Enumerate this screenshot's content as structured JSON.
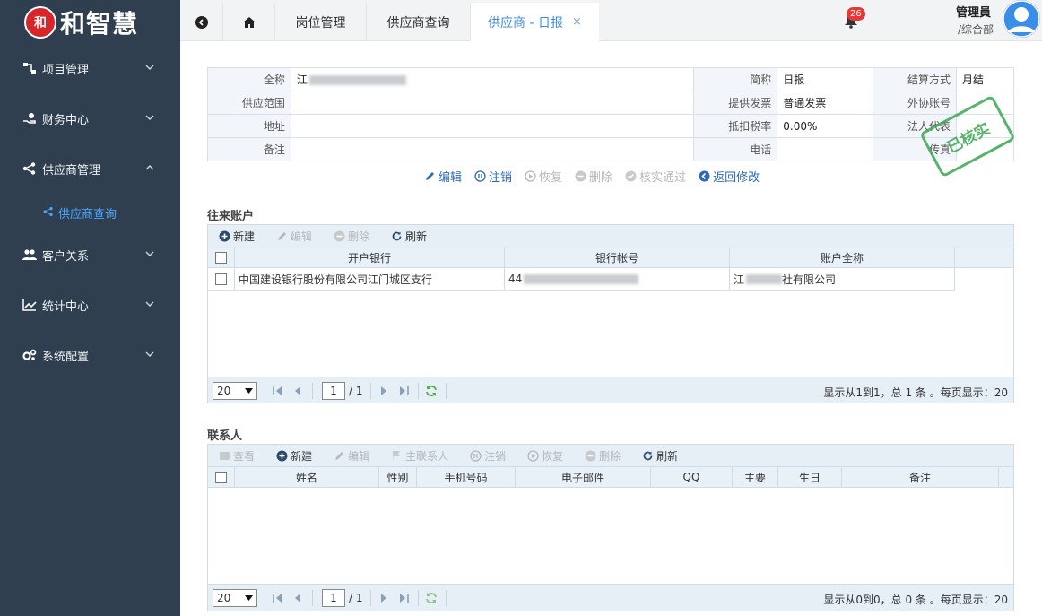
{
  "app": {
    "logo_mark": "和",
    "logo_text": "和智慧"
  },
  "sidebar": {
    "items": [
      {
        "label": "项目管理",
        "icon": "sitemap-icon"
      },
      {
        "label": "财务中心",
        "icon": "hand-coin-icon"
      },
      {
        "label": "供应商管理",
        "icon": "share-icon"
      },
      {
        "label": "客户关系",
        "icon": "users-icon"
      },
      {
        "label": "统计中心",
        "icon": "line-chart-icon"
      },
      {
        "label": "系统配置",
        "icon": "gears-icon"
      }
    ],
    "sub_items": [
      {
        "label": "供应商查询",
        "icon": "share-icon"
      }
    ]
  },
  "tabs": [
    {
      "label": "岗位管理"
    },
    {
      "label": "供应商查询"
    },
    {
      "label": "供应商 - 日报",
      "active": true,
      "close": "×"
    }
  ],
  "header": {
    "notification_count": "26",
    "user_name": "管理員",
    "user_dept": "/综合部"
  },
  "supplier": {
    "labels": {
      "full_name": "全称",
      "short_name": "简称",
      "settle": "结算方式",
      "scope": "供应范围",
      "invoice": "提供发票",
      "coop_account": "外协账号",
      "address": "地址",
      "tax_rate": "抵扣税率",
      "legal_rep": "法人代表",
      "remark": "备注",
      "phone": "电话",
      "fax": "传真"
    },
    "values": {
      "full_name": "江",
      "short_name": "日报",
      "settle": "月结",
      "scope": "",
      "invoice": "普通发票",
      "coop_account": "",
      "address": "",
      "tax_rate": "0.00%",
      "legal_rep": "",
      "remark": "",
      "phone": "",
      "fax": ""
    },
    "stamp": "已核实"
  },
  "actions": [
    {
      "label": "编辑",
      "icon": "pencil-icon",
      "enabled": true
    },
    {
      "label": "注销",
      "icon": "pause-icon",
      "enabled": true
    },
    {
      "label": "恢复",
      "icon": "play-icon",
      "enabled": false
    },
    {
      "label": "删除",
      "icon": "minus-icon",
      "enabled": false
    },
    {
      "label": "核实通过",
      "icon": "check-icon",
      "enabled": false
    },
    {
      "label": "返回修改",
      "icon": "arrow-left-icon",
      "enabled": true
    }
  ],
  "accounts": {
    "title": "往来账户",
    "toolbar": [
      {
        "label": "新建",
        "icon": "plus-circle-icon",
        "enabled": true
      },
      {
        "label": "编辑",
        "icon": "pencil-icon",
        "enabled": false
      },
      {
        "label": "删除",
        "icon": "minus-circle-icon",
        "enabled": false
      },
      {
        "label": "刷新",
        "icon": "refresh-icon",
        "enabled": true
      }
    ],
    "columns": [
      "开户银行",
      "银行帐号",
      "账户全称"
    ],
    "rows": [
      {
        "bank": "中国建设银行股份有限公司江门城区支行",
        "account": "44",
        "name": "江",
        "name_tail": "社有限公司"
      }
    ],
    "page_size": "20",
    "page": "1",
    "total_pages": "/ 1",
    "info": "显示从1到1，总 1 条 。每页显示：20"
  },
  "contacts": {
    "title": "联系人",
    "toolbar": [
      {
        "label": "查看",
        "icon": "view-icon",
        "enabled": false
      },
      {
        "label": "新建",
        "icon": "plus-circle-icon",
        "enabled": true
      },
      {
        "label": "编辑",
        "icon": "pencil-icon",
        "enabled": false
      },
      {
        "label": "主联系人",
        "icon": "flag-icon",
        "enabled": false
      },
      {
        "label": "注销",
        "icon": "pause-icon",
        "enabled": false
      },
      {
        "label": "恢复",
        "icon": "play-icon",
        "enabled": false
      },
      {
        "label": "删除",
        "icon": "minus-circle-icon",
        "enabled": false
      },
      {
        "label": "刷新",
        "icon": "refresh-icon",
        "enabled": true
      }
    ],
    "columns": [
      "姓名",
      "性别",
      "手机号码",
      "电子邮件",
      "QQ",
      "主要",
      "生日",
      "备注"
    ],
    "page_size": "20",
    "page": "1",
    "total_pages": "/ 1",
    "info": "显示从0到0，总 0 条 。每页显示：20"
  }
}
